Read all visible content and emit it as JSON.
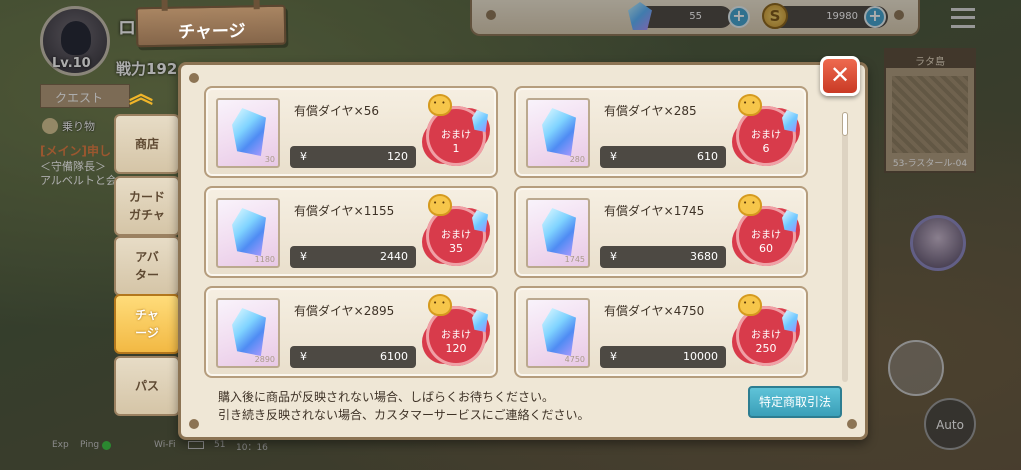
{
  "player": {
    "level": "Lv.10",
    "name_fragment": "ロ",
    "power": "戦力192"
  },
  "left_hud": {
    "quest_tab": "クエスト",
    "ride_label": "乗り物",
    "main_quest": "[メイン]申し",
    "quest_sub1": "＜守備隊長＞",
    "quest_sub2": "アルベルトと会"
  },
  "top_bar": {
    "gems": "55",
    "gold": "19980",
    "plus": "+",
    "coin_symbol": "S"
  },
  "minimap": {
    "header": "ラタ島",
    "footer": "53-ラスタール-04"
  },
  "auto_label": "Auto",
  "status_bar": {
    "exp": "Exp",
    "ping": "Ping",
    "wifi": "Wi-Fi",
    "battery": "51",
    "time": "10：16"
  },
  "title": "チャージ",
  "close_label": "✕",
  "nav": {
    "up_label": "︽",
    "items": [
      {
        "label": "商店"
      },
      {
        "label": "カード\nガチャ"
      },
      {
        "label": "アバ\nター"
      },
      {
        "label": "チャ\nージ"
      },
      {
        "label": "パス"
      }
    ]
  },
  "products": [
    {
      "name": "有償ダイヤ×56",
      "thumb": "30",
      "currency": "¥",
      "price": "120",
      "bonus_label": "おまけ",
      "bonus": "1"
    },
    {
      "name": "有償ダイヤ×285",
      "thumb": "280",
      "currency": "¥",
      "price": "610",
      "bonus_label": "おまけ",
      "bonus": "6"
    },
    {
      "name": "有償ダイヤ×1155",
      "thumb": "1180",
      "currency": "¥",
      "price": "2440",
      "bonus_label": "おまけ",
      "bonus": "35"
    },
    {
      "name": "有償ダイヤ×1745",
      "thumb": "1745",
      "currency": "¥",
      "price": "3680",
      "bonus_label": "おまけ",
      "bonus": "60"
    },
    {
      "name": "有償ダイヤ×2895",
      "thumb": "2890",
      "currency": "¥",
      "price": "6100",
      "bonus_label": "おまけ",
      "bonus": "120"
    },
    {
      "name": "有償ダイヤ×4750",
      "thumb": "4750",
      "currency": "¥",
      "price": "10000",
      "bonus_label": "おまけ",
      "bonus": "250"
    }
  ],
  "notice": {
    "line1": "購入後に商品が反映されない場合、しばらくお待ちください。",
    "line2": "引き続き反映されない場合、カスタマーサービスにご連絡ください。"
  },
  "legal_button": "特定商取引法"
}
